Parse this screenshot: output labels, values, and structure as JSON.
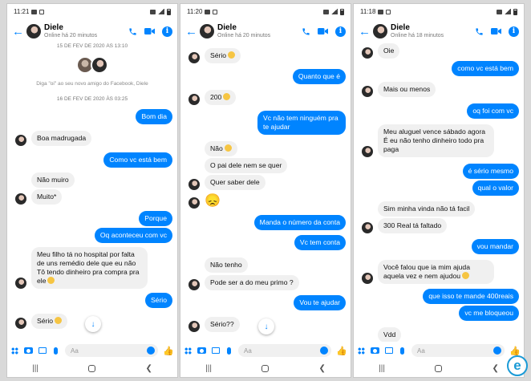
{
  "screens": [
    {
      "status_time": "11:21",
      "contact_name": "Diele",
      "contact_status": "Online há 20 minutos",
      "composer_placeholder": "Aa",
      "day_sep_1": "15 DE FEV DE 2020 ÀS 13:10",
      "hint_text": "Diga \"oi\" ao seu novo amigo do Facebook, Diele",
      "day_sep_2": "16 DE FEV DE 2020 ÀS 03:25",
      "messages": [
        {
          "dir": "out",
          "text": "Bom dia"
        },
        {
          "dir": "in",
          "text": "Boa madrugada"
        },
        {
          "dir": "out",
          "text": "Como vc está bem"
        },
        {
          "dir": "in",
          "text": "Não muiro"
        },
        {
          "dir": "in",
          "text": "Muito*"
        },
        {
          "dir": "out",
          "text": "Porque"
        },
        {
          "dir": "out",
          "text": "Oq aconteceu com vc"
        },
        {
          "dir": "in",
          "text": "Meu filho tá no hospital por falta de uns remédio dele que eu não Tô tendo dinheiro pra compra pra ele",
          "emoji": "sad-face"
        },
        {
          "dir": "out",
          "text": "Sério"
        },
        {
          "dir": "in",
          "text": "Sério",
          "emoji": "sad-face"
        }
      ]
    },
    {
      "status_time": "11:20",
      "contact_name": "Diele",
      "contact_status": "Online há 20 minutos",
      "composer_placeholder": "Aa",
      "messages": [
        {
          "dir": "in",
          "text": "Sério",
          "emoji": "sad-face"
        },
        {
          "dir": "out",
          "text": "Quanto que é"
        },
        {
          "dir": "in",
          "text": "200",
          "emoji": "sad-face"
        },
        {
          "dir": "out",
          "text": "Vc não tem ninguém pra te ajudar"
        },
        {
          "dir": "in",
          "text": "Não",
          "emoji": "sad-face"
        },
        {
          "dir": "in",
          "text": "O pai dele nem se quer"
        },
        {
          "dir": "in",
          "text": "Quer saber dele"
        },
        {
          "dir": "in",
          "text": "😞",
          "big_emoji": true
        },
        {
          "dir": "out",
          "text": "Manda o número da conta"
        },
        {
          "dir": "out",
          "text": "Vc tem conta"
        },
        {
          "dir": "in",
          "text": "Não tenho"
        },
        {
          "dir": "in",
          "text": "Pode ser a do meu primo ?"
        },
        {
          "dir": "out",
          "text": "Vou te ajudar"
        },
        {
          "dir": "in",
          "text": "Sério??"
        }
      ]
    },
    {
      "status_time": "11:18",
      "contact_name": "Diele",
      "contact_status": "Online há 18 minutos",
      "composer_placeholder": "Aa",
      "messages": [
        {
          "dir": "in",
          "text": "Oie"
        },
        {
          "dir": "out",
          "text": "como vc está bem"
        },
        {
          "dir": "in",
          "text": "Mais ou menos"
        },
        {
          "dir": "out",
          "text": "oq foi com vc"
        },
        {
          "dir": "in",
          "text": "Meu aluguel vence sábado agora É eu não tenho dinheiro todo pra paga"
        },
        {
          "dir": "out",
          "text": "é sério mesmo"
        },
        {
          "dir": "out",
          "text": "qual o valor"
        },
        {
          "dir": "in",
          "text": "Sim minha vinda não tá facil"
        },
        {
          "dir": "in",
          "text": "300 Real tá faltado"
        },
        {
          "dir": "out",
          "text": "vou mandar"
        },
        {
          "dir": "in",
          "text": "Você falou que ia mim ajuda aquela vez e nem ajudou",
          "emoji": "sad-face"
        },
        {
          "dir": "out",
          "text": "que isso te mande 400reais"
        },
        {
          "dir": "out",
          "text": "vc me bloqueou"
        },
        {
          "dir": "in",
          "text": "Vdd"
        }
      ]
    }
  ],
  "colors": {
    "accent": "#0084ff",
    "incoming_bubble": "#f0f0f0",
    "background": "#d9d9d9"
  },
  "watermark_letter": "e"
}
